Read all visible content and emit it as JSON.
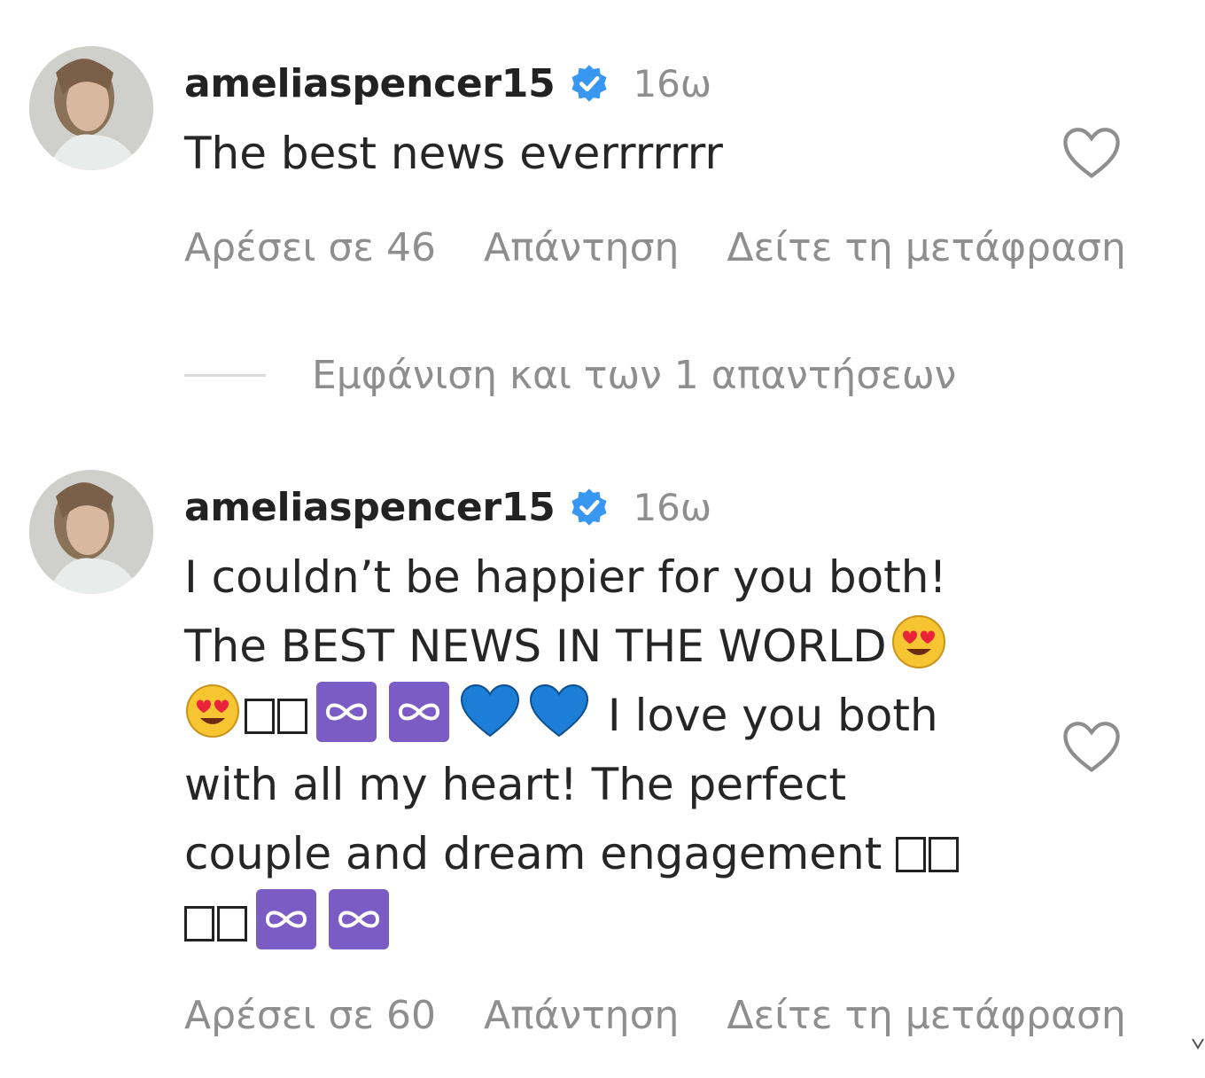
{
  "colors": {
    "verified_badge": "#3897f0",
    "secondary_text": "#8e8e8e",
    "infinity_tile": "#7b5cc4",
    "blue_heart": "#1c7ed6"
  },
  "comments": [
    {
      "username": "ameliaspencer15",
      "time": "16ω",
      "text": "The best news everrrrrrr",
      "likes_label": "Αρέσει σε 46",
      "reply_label": "Απάντηση",
      "translate_label": "Δείτε τη μετάφραση",
      "view_replies_label": "Εμφάνιση και των 1 απαντήσεων"
    },
    {
      "username": "ameliaspencer15",
      "time": "16ω",
      "text_lines": {
        "line1": "I couldn’t be happier for you both!",
        "line2": "The BEST NEWS IN THE WORLD",
        "line3": "I love you both",
        "line4": "with all my heart! The perfect",
        "line5": "couple and dream engagement"
      },
      "likes_label": "Αρέσει σε 60",
      "reply_label": "Απάντηση",
      "translate_label": "Δείτε τη μετάφραση"
    }
  ],
  "icons": {
    "avatar": "avatar-image",
    "verified": "verified-badge-icon",
    "like": "heart-outline-icon",
    "emoji_heart_eyes": "smiling-face-heart-eyes-icon",
    "emoji_infinity": "infinity-icon",
    "emoji_blue_heart": "blue-heart-icon",
    "emoji_missing": "missing-glyph-box-icon"
  }
}
